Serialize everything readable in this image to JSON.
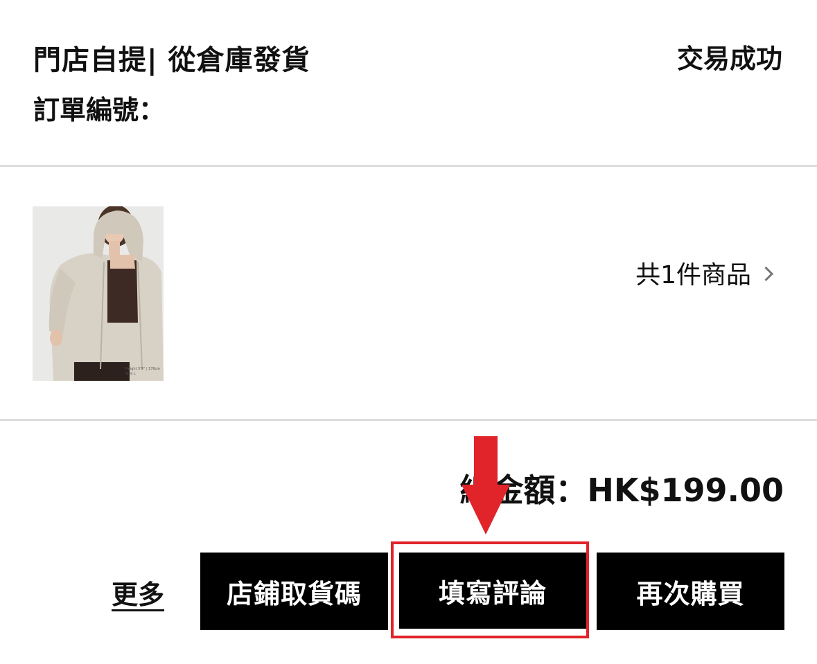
{
  "order": {
    "type_label": "門店自提| 從倉庫發貨",
    "status": "交易成功",
    "number_label": "訂單編號："
  },
  "product": {
    "image_alt": "jacket-model-photo",
    "caption_line1": "Height 5'9\" | 176cm",
    "caption_line2": "Size L",
    "item_count_label": "共1件商品"
  },
  "summary": {
    "total_label": "總金額：HK$199.00"
  },
  "actions": {
    "more_label": "更多",
    "pickup_code_label": "店鋪取貨碼",
    "write_review_label": "填寫評論",
    "buy_again_label": "再次購買"
  },
  "colors": {
    "button_bg": "#000000",
    "button_text": "#ffffff",
    "highlight": "#e0242a",
    "divider": "#dcdcdc"
  }
}
